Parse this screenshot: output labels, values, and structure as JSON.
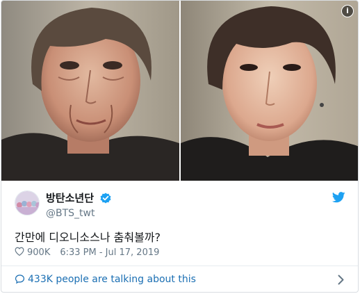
{
  "media": {
    "info_glyph": "i",
    "left_photo": "aged-face-photo",
    "right_photo": "young-face-photo"
  },
  "tweet": {
    "display_name": "방탄소년단",
    "handle": "@BTS_twt",
    "text": "간만에 디오니소스나 춤춰볼까?",
    "likes": "900K",
    "timestamp": "6:33 PM - Jul 17, 2019",
    "talking": "433K people are talking about this"
  },
  "icons": {
    "verified": "verified-badge-icon",
    "bird": "twitter-bird-icon",
    "heart": "heart-icon",
    "bubble": "comment-bubble-icon",
    "chevron": "chevron-right-icon"
  },
  "colors": {
    "brand_blue": "#1da1f2",
    "link_blue": "#1b6fb3",
    "muted": "#657786",
    "text": "#14171a"
  }
}
